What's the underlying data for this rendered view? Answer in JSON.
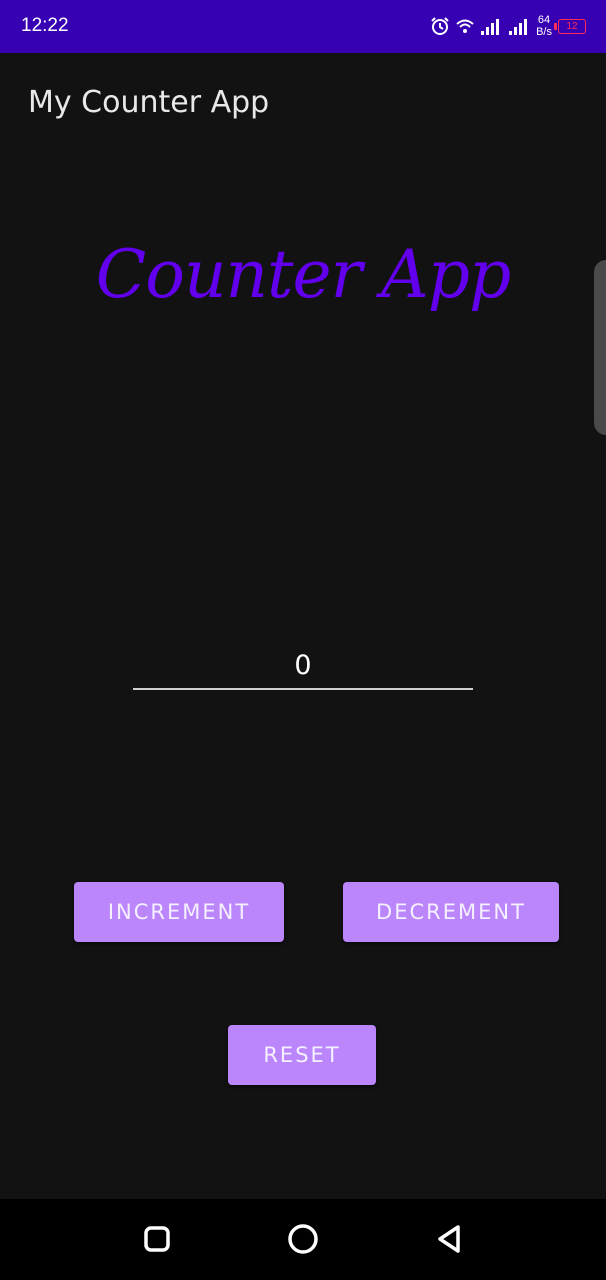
{
  "status_bar": {
    "time": "12:22",
    "speed_value": "64",
    "speed_unit": "B/s",
    "battery": "12",
    "icons": [
      "alarm-icon",
      "wifi-icon",
      "signal-icon",
      "signal-icon",
      "battery-icon"
    ]
  },
  "app_bar": {
    "title": "My Counter App"
  },
  "main": {
    "heading": "Counter App",
    "counter_value": "0",
    "increment_label": "INCREMENT",
    "decrement_label": "DECREMENT",
    "reset_label": "RESET"
  },
  "nav_bar": {
    "icons": [
      "recent-apps-icon",
      "home-icon",
      "back-icon"
    ]
  },
  "colors": {
    "status_bar": "#3700B3",
    "primary": "#6200EE",
    "button": "#BB86FC",
    "background": "#121212",
    "battery_low": "#FF2D55"
  }
}
